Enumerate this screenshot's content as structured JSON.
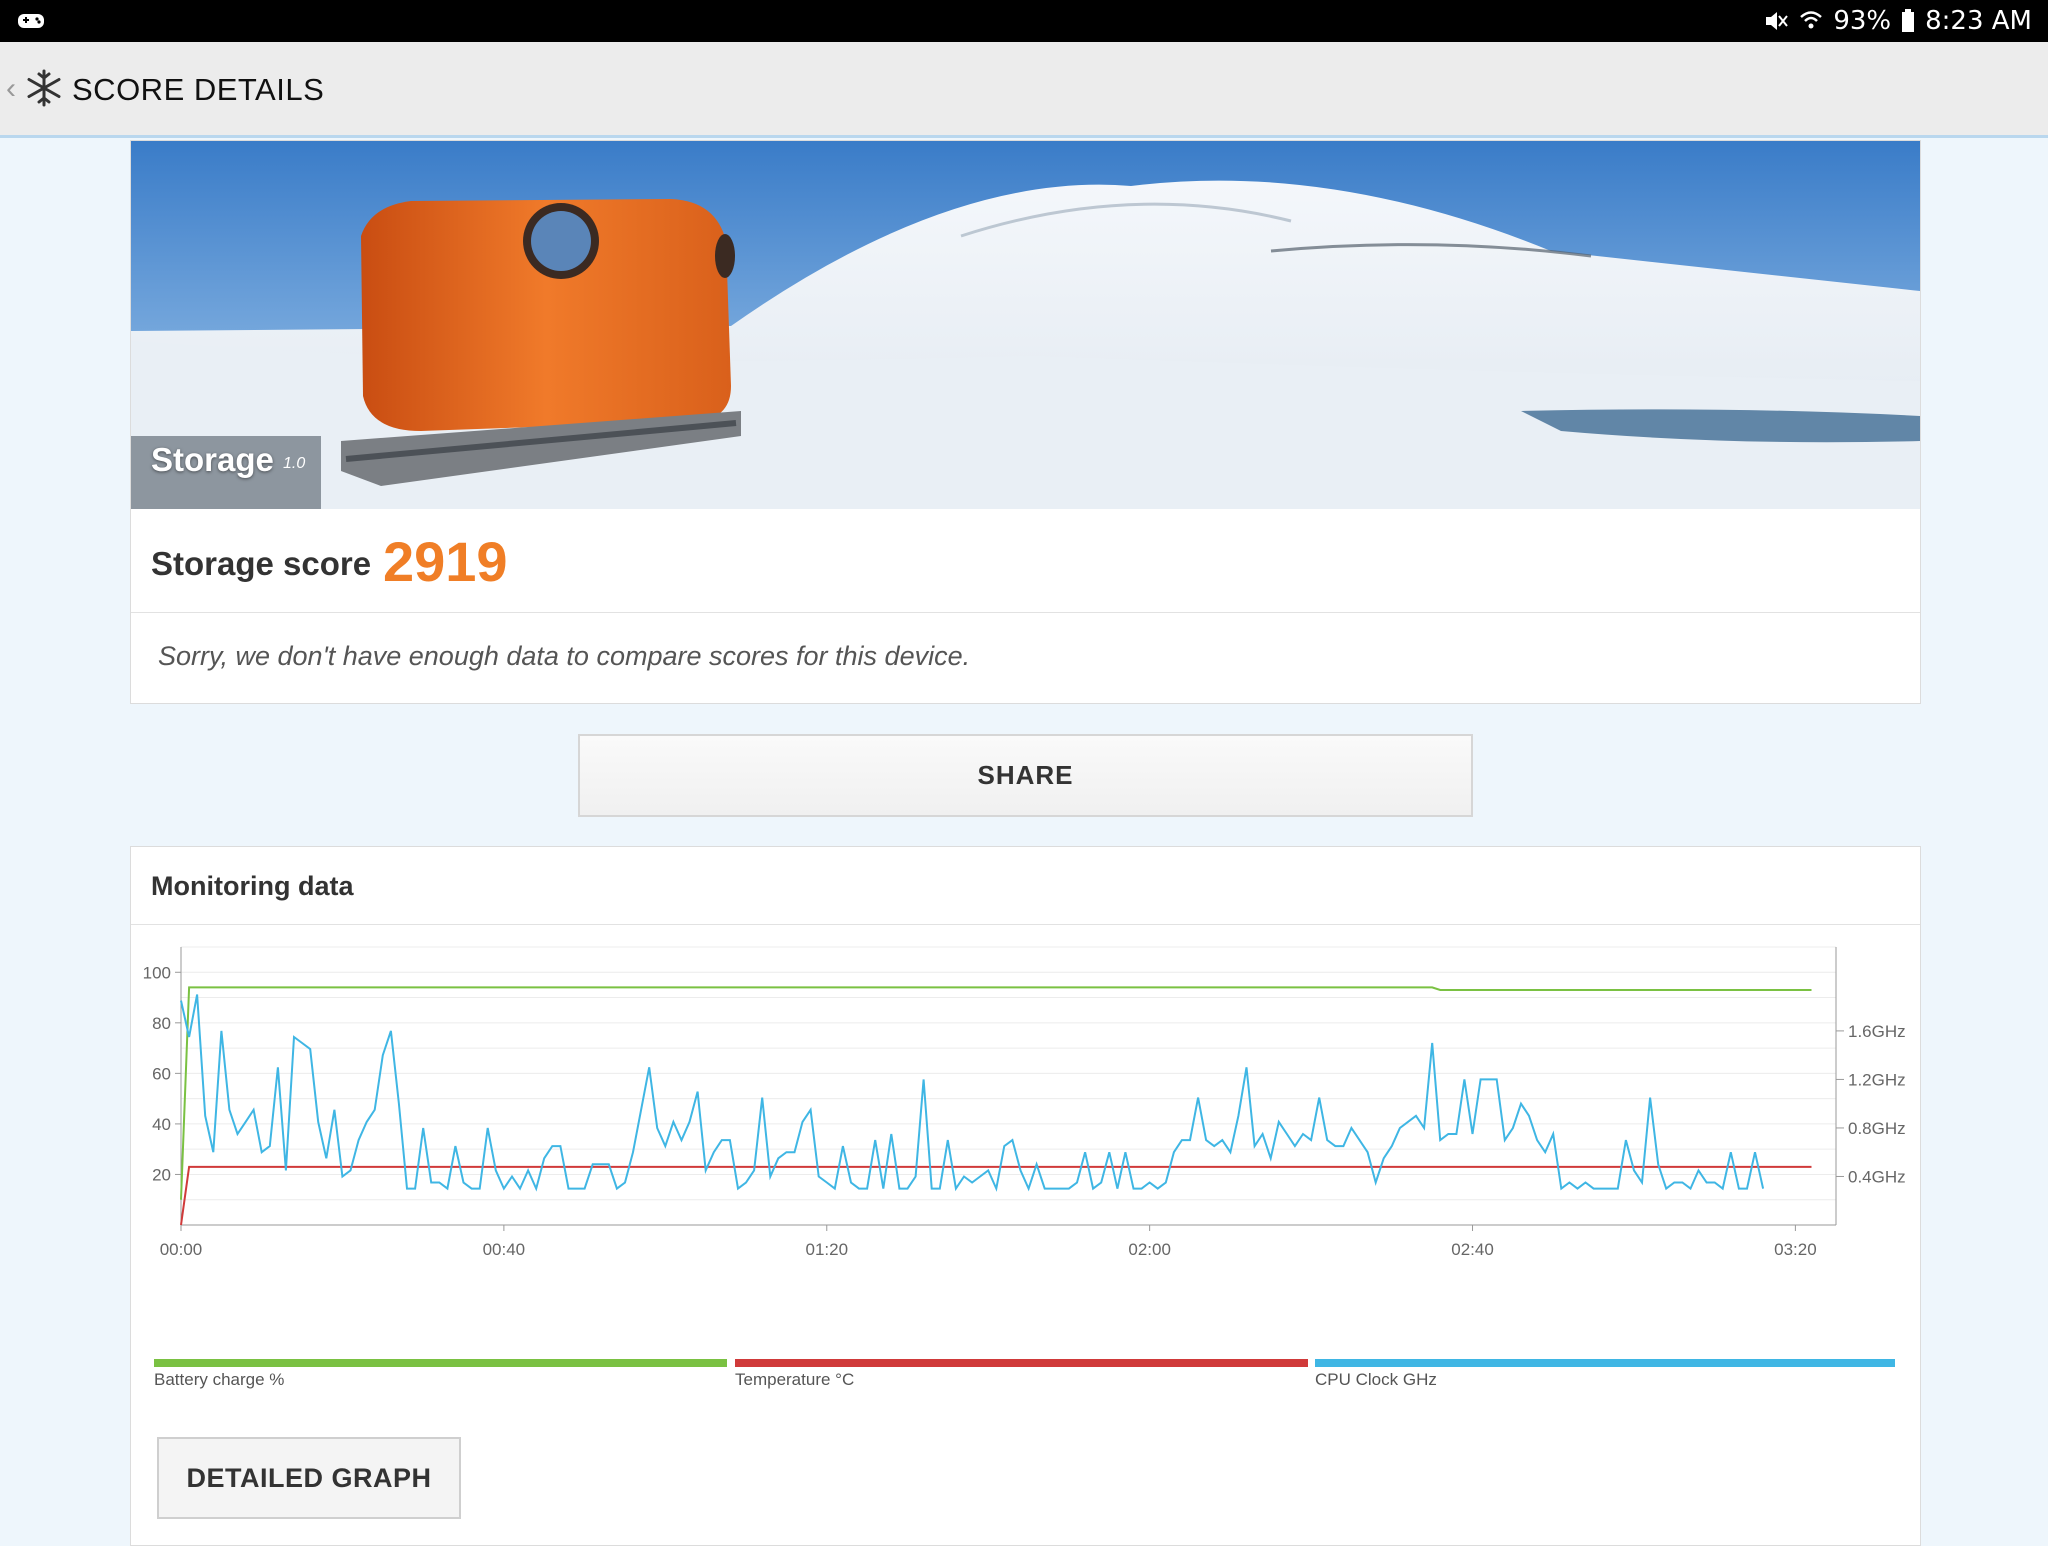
{
  "status_bar": {
    "battery": "93%",
    "time": "8:23 AM",
    "icons": [
      "game-controller-icon",
      "mute-icon",
      "wifi-icon",
      "battery-icon"
    ]
  },
  "app_bar": {
    "title": "SCORE DETAILS",
    "back_icon": "chevron-left-icon",
    "logo_icon": "snowflake-icon"
  },
  "score_card": {
    "test_name": "Storage",
    "test_version": "1.0",
    "score_label": "Storage score",
    "score_value": "2919",
    "compare_message": "Sorry, we don't have enough data to compare scores for this device.",
    "accent_color": "#f07e26"
  },
  "share_button": {
    "label": "SHARE"
  },
  "monitoring": {
    "title": "Monitoring data",
    "left_ticks": [
      "100",
      "80",
      "60",
      "40",
      "20"
    ],
    "right_ticks": [
      "1.6GHz",
      "1.2GHz",
      "0.8GHz",
      "0.4GHz"
    ],
    "x_ticks": [
      "00:00",
      "00:40",
      "01:20",
      "02:00",
      "02:40",
      "03:20"
    ],
    "legend": [
      {
        "label": "Battery charge %",
        "color": "#7ac142"
      },
      {
        "label": "Temperature °C",
        "color": "#d03a3a"
      },
      {
        "label": "CPU Clock GHz",
        "color": "#3fb6e4"
      }
    ],
    "detailed_button": "DETAILED GRAPH"
  },
  "chart_data": {
    "type": "line",
    "x_unit": "time (mm:ss)",
    "x_range": [
      0,
      202
    ],
    "y_left_range": [
      0,
      100
    ],
    "series": [
      {
        "name": "Battery charge %",
        "points": [
          [
            0,
            10
          ],
          [
            1,
            94
          ],
          [
            155,
            94
          ],
          [
            156,
            93
          ],
          [
            202,
            93
          ]
        ]
      },
      {
        "name": "Temperature °C",
        "points": [
          [
            0,
            0
          ],
          [
            1,
            23
          ],
          [
            100,
            23
          ],
          [
            120,
            23
          ],
          [
            202,
            23
          ]
        ]
      },
      {
        "name": "CPU Clock GHz",
        "points": [
          [
            0,
            1.85
          ],
          [
            1,
            1.55
          ],
          [
            2,
            1.9
          ],
          [
            3,
            0.9
          ],
          [
            4,
            0.6
          ],
          [
            5,
            1.6
          ],
          [
            6,
            0.95
          ],
          [
            7,
            0.75
          ],
          [
            8,
            0.85
          ],
          [
            9,
            0.95
          ],
          [
            10,
            0.6
          ],
          [
            11,
            0.65
          ],
          [
            12,
            1.3
          ],
          [
            13,
            0.45
          ],
          [
            14,
            1.55
          ],
          [
            15,
            1.5
          ],
          [
            16,
            1.45
          ],
          [
            17,
            0.85
          ],
          [
            18,
            0.55
          ],
          [
            19,
            0.95
          ],
          [
            20,
            0.4
          ],
          [
            21,
            0.45
          ],
          [
            22,
            0.7
          ],
          [
            23,
            0.85
          ],
          [
            24,
            0.95
          ],
          [
            25,
            1.4
          ],
          [
            26,
            1.6
          ],
          [
            27,
            1.0
          ],
          [
            28,
            0.3
          ],
          [
            29,
            0.3
          ],
          [
            30,
            0.8
          ],
          [
            31,
            0.35
          ],
          [
            32,
            0.35
          ],
          [
            33,
            0.3
          ],
          [
            34,
            0.65
          ],
          [
            35,
            0.35
          ],
          [
            36,
            0.3
          ],
          [
            37,
            0.3
          ],
          [
            38,
            0.8
          ],
          [
            39,
            0.45
          ],
          [
            40,
            0.3
          ],
          [
            41,
            0.4
          ],
          [
            42,
            0.3
          ],
          [
            43,
            0.45
          ],
          [
            44,
            0.3
          ],
          [
            45,
            0.55
          ],
          [
            46,
            0.65
          ],
          [
            47,
            0.65
          ],
          [
            48,
            0.3
          ],
          [
            49,
            0.3
          ],
          [
            50,
            0.3
          ],
          [
            51,
            0.5
          ],
          [
            52,
            0.5
          ],
          [
            53,
            0.5
          ],
          [
            54,
            0.3
          ],
          [
            55,
            0.35
          ],
          [
            56,
            0.6
          ],
          [
            57,
            0.95
          ],
          [
            58,
            1.3
          ],
          [
            59,
            0.8
          ],
          [
            60,
            0.65
          ],
          [
            61,
            0.85
          ],
          [
            62,
            0.7
          ],
          [
            63,
            0.85
          ],
          [
            64,
            1.1
          ],
          [
            65,
            0.45
          ],
          [
            66,
            0.6
          ],
          [
            67,
            0.7
          ],
          [
            68,
            0.7
          ],
          [
            69,
            0.3
          ],
          [
            70,
            0.35
          ],
          [
            71,
            0.45
          ],
          [
            72,
            1.05
          ],
          [
            73,
            0.4
          ],
          [
            74,
            0.55
          ],
          [
            75,
            0.6
          ],
          [
            76,
            0.6
          ],
          [
            77,
            0.85
          ],
          [
            78,
            0.95
          ],
          [
            79,
            0.4
          ],
          [
            80,
            0.35
          ],
          [
            81,
            0.3
          ],
          [
            82,
            0.65
          ],
          [
            83,
            0.35
          ],
          [
            84,
            0.3
          ],
          [
            85,
            0.3
          ],
          [
            86,
            0.7
          ],
          [
            87,
            0.3
          ],
          [
            88,
            0.75
          ],
          [
            89,
            0.3
          ],
          [
            90,
            0.3
          ],
          [
            91,
            0.4
          ],
          [
            92,
            1.2
          ],
          [
            93,
            0.3
          ],
          [
            94,
            0.3
          ],
          [
            95,
            0.7
          ],
          [
            96,
            0.3
          ],
          [
            97,
            0.4
          ],
          [
            98,
            0.35
          ],
          [
            99,
            0.4
          ],
          [
            100,
            0.45
          ],
          [
            101,
            0.3
          ],
          [
            102,
            0.65
          ],
          [
            103,
            0.7
          ],
          [
            104,
            0.45
          ],
          [
            105,
            0.3
          ],
          [
            106,
            0.5
          ],
          [
            107,
            0.3
          ],
          [
            108,
            0.3
          ],
          [
            109,
            0.3
          ],
          [
            110,
            0.3
          ],
          [
            111,
            0.35
          ],
          [
            112,
            0.6
          ],
          [
            113,
            0.3
          ],
          [
            114,
            0.35
          ],
          [
            115,
            0.6
          ],
          [
            116,
            0.3
          ],
          [
            117,
            0.6
          ],
          [
            118,
            0.3
          ],
          [
            119,
            0.3
          ],
          [
            120,
            0.35
          ],
          [
            121,
            0.3
          ],
          [
            122,
            0.35
          ],
          [
            123,
            0.6
          ],
          [
            124,
            0.7
          ],
          [
            125,
            0.7
          ],
          [
            126,
            1.05
          ],
          [
            127,
            0.7
          ],
          [
            128,
            0.65
          ],
          [
            129,
            0.7
          ],
          [
            130,
            0.6
          ],
          [
            131,
            0.9
          ],
          [
            132,
            1.3
          ],
          [
            133,
            0.65
          ],
          [
            134,
            0.75
          ],
          [
            135,
            0.55
          ],
          [
            136,
            0.85
          ],
          [
            137,
            0.75
          ],
          [
            138,
            0.65
          ],
          [
            139,
            0.75
          ],
          [
            140,
            0.7
          ],
          [
            141,
            1.05
          ],
          [
            142,
            0.7
          ],
          [
            143,
            0.65
          ],
          [
            144,
            0.65
          ],
          [
            145,
            0.8
          ],
          [
            146,
            0.7
          ],
          [
            147,
            0.6
          ],
          [
            148,
            0.35
          ],
          [
            149,
            0.55
          ],
          [
            150,
            0.65
          ],
          [
            151,
            0.8
          ],
          [
            152,
            0.85
          ],
          [
            153,
            0.9
          ],
          [
            154,
            0.8
          ],
          [
            155,
            1.5
          ],
          [
            156,
            0.7
          ],
          [
            157,
            0.75
          ],
          [
            158,
            0.75
          ],
          [
            159,
            1.2
          ],
          [
            160,
            0.75
          ],
          [
            161,
            1.2
          ],
          [
            162,
            1.2
          ],
          [
            163,
            1.2
          ],
          [
            164,
            0.7
          ],
          [
            165,
            0.8
          ],
          [
            166,
            1.0
          ],
          [
            167,
            0.9
          ],
          [
            168,
            0.7
          ],
          [
            169,
            0.6
          ],
          [
            170,
            0.75
          ],
          [
            171,
            0.3
          ],
          [
            172,
            0.35
          ],
          [
            173,
            0.3
          ],
          [
            174,
            0.35
          ],
          [
            175,
            0.3
          ],
          [
            176,
            0.3
          ],
          [
            177,
            0.3
          ],
          [
            178,
            0.3
          ],
          [
            179,
            0.7
          ],
          [
            180,
            0.45
          ],
          [
            181,
            0.35
          ],
          [
            182,
            1.05
          ],
          [
            183,
            0.5
          ],
          [
            184,
            0.3
          ],
          [
            185,
            0.35
          ],
          [
            186,
            0.35
          ],
          [
            187,
            0.3
          ],
          [
            188,
            0.45
          ],
          [
            189,
            0.35
          ],
          [
            190,
            0.35
          ],
          [
            191,
            0.3
          ],
          [
            192,
            0.6
          ],
          [
            193,
            0.3
          ],
          [
            194,
            0.3
          ],
          [
            195,
            0.6
          ],
          [
            196,
            0.3
          ]
        ]
      }
    ]
  }
}
